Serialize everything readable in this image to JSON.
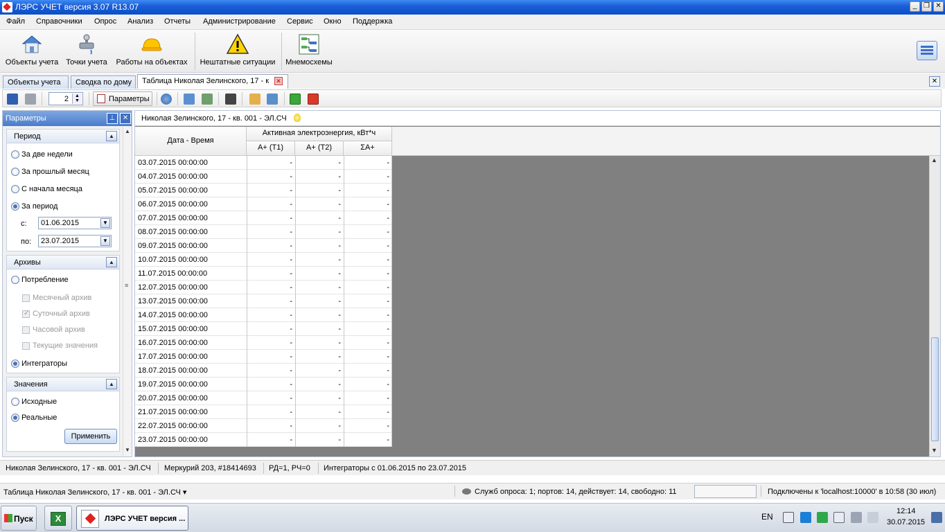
{
  "window": {
    "title": "ЛЭРС УЧЕТ версия 3.07 R13.07"
  },
  "menu": [
    "Файл",
    "Справочники",
    "Опрос",
    "Анализ",
    "Отчеты",
    "Администрирование",
    "Сервис",
    "Окно",
    "Поддержка"
  ],
  "bigtoolbar": {
    "objects": "Объекты учета",
    "points": "Точки учета",
    "works": "Работы на объектах",
    "emergency": "Нештатные ситуации",
    "schemes": "Мнемосхемы"
  },
  "tabs": [
    {
      "label": "Объекты учета"
    },
    {
      "label": "Сводка по дому"
    },
    {
      "label": "Таблица Николая Зелинского, 17 - к"
    }
  ],
  "toolbar": {
    "spin_value": "2",
    "params_label": "Параметры"
  },
  "params": {
    "title": "Параметры",
    "period": {
      "header": "Период",
      "options": [
        "За две недели",
        "За прошлый месяц",
        "С начала месяца",
        "За период"
      ],
      "from_label": "с:",
      "from": "01.06.2015",
      "to_label": "по:",
      "to": "23.07.2015"
    },
    "archives": {
      "header": "Архивы",
      "consumption": "Потребление",
      "checks": [
        "Месячный архив",
        "Суточный архив",
        "Часовой архив",
        "Текущие значения"
      ],
      "integrators": "Интеграторы"
    },
    "values": {
      "header": "Значения",
      "source": "Исходные",
      "real": "Реальные"
    },
    "apply": "Применить"
  },
  "main": {
    "title": "Николая Зелинского, 17 - кв. 001 - ЭЛ.СЧ",
    "date_header": "Дата - Время",
    "group_header": "Активная электроэнергия, кВт*ч",
    "col_headers": [
      "A+ (T1)",
      "A+ (T2)",
      "ΣA+"
    ],
    "rows": [
      [
        "03.07.2015 00:00:00",
        "-",
        "-",
        "-"
      ],
      [
        "04.07.2015 00:00:00",
        "-",
        "-",
        "-"
      ],
      [
        "05.07.2015 00:00:00",
        "-",
        "-",
        "-"
      ],
      [
        "06.07.2015 00:00:00",
        "-",
        "-",
        "-"
      ],
      [
        "07.07.2015 00:00:00",
        "-",
        "-",
        "-"
      ],
      [
        "08.07.2015 00:00:00",
        "-",
        "-",
        "-"
      ],
      [
        "09.07.2015 00:00:00",
        "-",
        "-",
        "-"
      ],
      [
        "10.07.2015 00:00:00",
        "-",
        "-",
        "-"
      ],
      [
        "11.07.2015 00:00:00",
        "-",
        "-",
        "-"
      ],
      [
        "12.07.2015 00:00:00",
        "-",
        "-",
        "-"
      ],
      [
        "13.07.2015 00:00:00",
        "-",
        "-",
        "-"
      ],
      [
        "14.07.2015 00:00:00",
        "-",
        "-",
        "-"
      ],
      [
        "15.07.2015 00:00:00",
        "-",
        "-",
        "-"
      ],
      [
        "16.07.2015 00:00:00",
        "-",
        "-",
        "-"
      ],
      [
        "17.07.2015 00:00:00",
        "-",
        "-",
        "-"
      ],
      [
        "18.07.2015 00:00:00",
        "-",
        "-",
        "-"
      ],
      [
        "19.07.2015 00:00:00",
        "-",
        "-",
        "-"
      ],
      [
        "20.07.2015 00:00:00",
        "-",
        "-",
        "-"
      ],
      [
        "21.07.2015 00:00:00",
        "-",
        "-",
        "-"
      ],
      [
        "22.07.2015 00:00:00",
        "-",
        "-",
        "-"
      ],
      [
        "23.07.2015 00:00:00",
        "-",
        "-",
        "-"
      ]
    ]
  },
  "status1": [
    "Николая Зелинского, 17 - кв. 001 - ЭЛ.СЧ",
    "Меркурий 203, #18414693",
    "РД=1, РЧ=0",
    "Интеграторы с 01.06.2015 по 23.07.2015"
  ],
  "status2": {
    "window": "Таблица Николая Зелинского, 17 - кв. 001 - ЭЛ.СЧ ▾",
    "services": "Служб опроса: 1; портов: 14, действует: 14, свободно: 11",
    "connection": "Подключены к 'localhost:10000' в 10:58 (30 июл)"
  },
  "taskbar": {
    "start": "Пуск",
    "app": "ЛЭРС УЧЕТ версия ...",
    "lang": "EN",
    "time": "12:14",
    "date": "30.07.2015"
  },
  "colors": {
    "titlebar": "#1c5fd7",
    "grid_background": "#808080",
    "accent": "#4a7ccc"
  }
}
